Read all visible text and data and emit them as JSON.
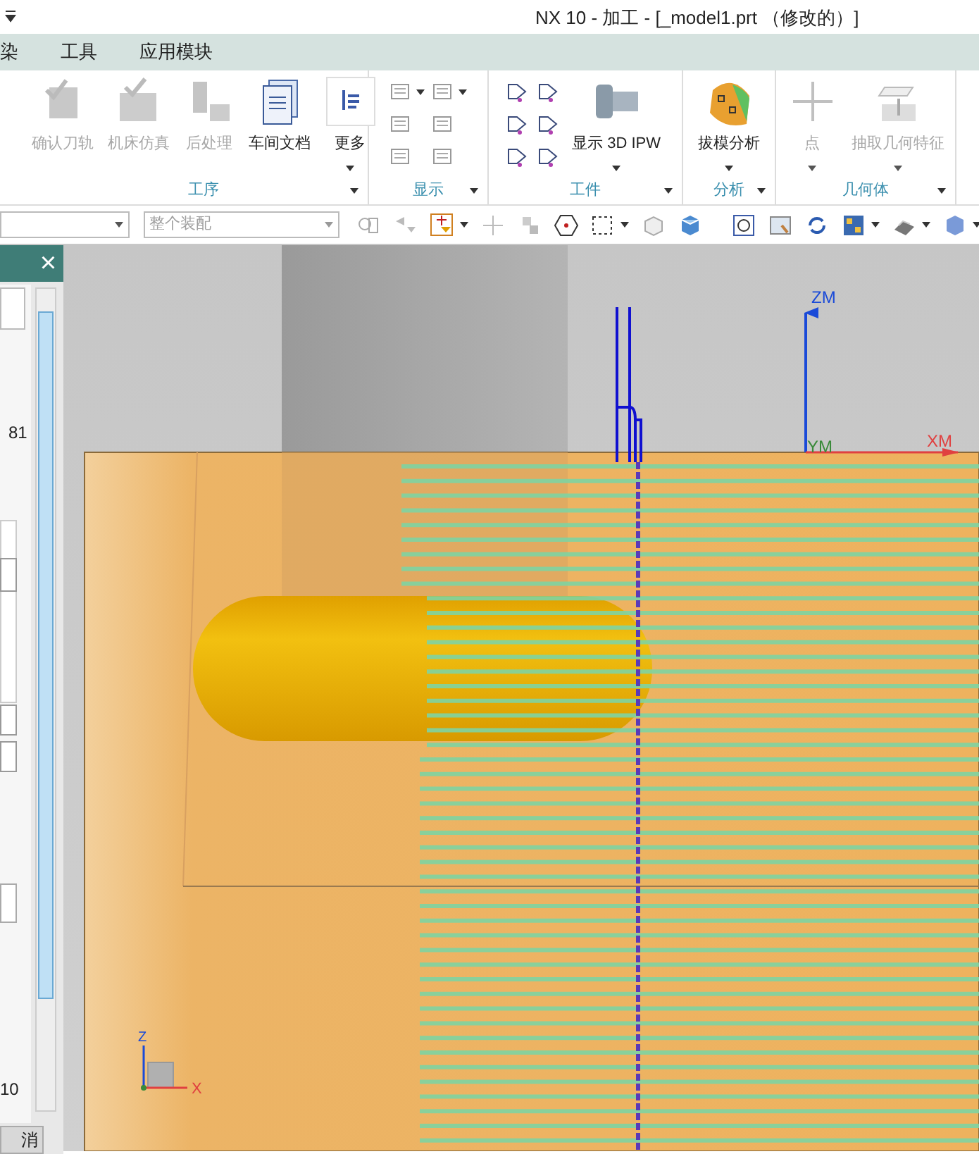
{
  "window": {
    "title": "NX 10 - 加工 - [_model1.prt （修改的）]"
  },
  "menu": [
    {
      "label": "染"
    },
    {
      "label": "工具"
    },
    {
      "label": "应用模块"
    }
  ],
  "ribbon": {
    "groups": [
      {
        "label": "工序",
        "launcher": true,
        "buttons": [
          {
            "kind": "large",
            "label": "确认刀轨",
            "disabled": true,
            "dropdown": false
          },
          {
            "kind": "large",
            "label": "机床仿真",
            "disabled": true,
            "dropdown": false
          },
          {
            "kind": "large",
            "label": "后处理",
            "disabled": true,
            "dropdown": false
          },
          {
            "kind": "large",
            "label": "车间文档",
            "disabled": false,
            "dropdown": false
          },
          {
            "kind": "large",
            "label": "更多",
            "disabled": false,
            "dropdown": true
          }
        ]
      },
      {
        "label": "显示",
        "launcher": true,
        "buttons": [
          {
            "kind": "small",
            "dropdown": true
          },
          {
            "kind": "small",
            "dropdown": false
          },
          {
            "kind": "small",
            "dropdown": false
          },
          {
            "kind": "small",
            "dropdown": true
          },
          {
            "kind": "small",
            "dropdown": false
          },
          {
            "kind": "small",
            "dropdown": false
          }
        ]
      },
      {
        "label": "工件",
        "launcher": true,
        "buttons": [
          {
            "kind": "small",
            "dropdown": false
          },
          {
            "kind": "small",
            "dropdown": false
          },
          {
            "kind": "small",
            "dropdown": false
          },
          {
            "kind": "small",
            "dropdown": false
          },
          {
            "kind": "small",
            "dropdown": false
          },
          {
            "kind": "small",
            "dropdown": false
          },
          {
            "kind": "large",
            "label": "显示 3D IPW",
            "disabled": false,
            "dropdown": true
          }
        ]
      },
      {
        "label": "分析",
        "launcher": true,
        "buttons": [
          {
            "kind": "large",
            "label": "拔模分析",
            "disabled": false,
            "dropdown": true
          }
        ]
      },
      {
        "label": "几何体",
        "launcher": true,
        "buttons": [
          {
            "kind": "large",
            "label": "点",
            "disabled": true,
            "dropdown": true
          },
          {
            "kind": "large",
            "label": "抽取几何特征",
            "disabled": true,
            "dropdown": true
          }
        ]
      }
    ]
  },
  "toolbar": {
    "combos": [
      {
        "disabled": false
      },
      {
        "value": "整个装配",
        "disabled": true
      }
    ]
  },
  "panel": {
    "close": "×",
    "values": [
      "81",
      "10"
    ],
    "cancel": "消"
  },
  "viewport": {
    "csys": {
      "z": "ZM",
      "y": "YM",
      "x": "XM"
    },
    "triad": {
      "z": "Z",
      "x": "X"
    }
  }
}
